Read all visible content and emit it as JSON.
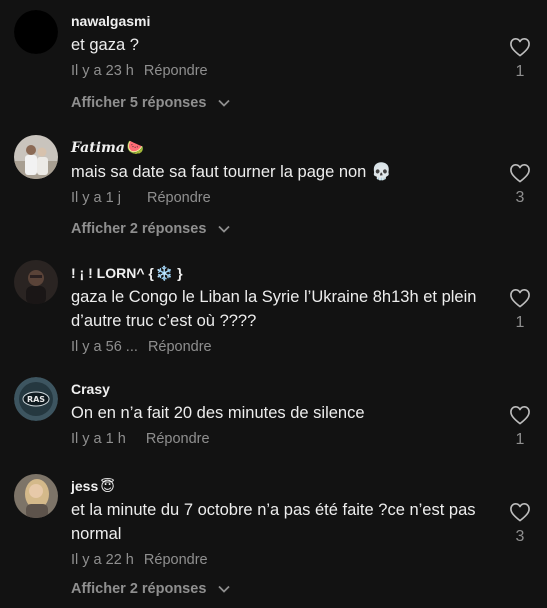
{
  "comments": [
    {
      "username": "nawalgasmi",
      "username_extra": "",
      "text": "et gaza ?",
      "time": "Il y a 23 h",
      "reply_label": "Répondre",
      "likes": "1",
      "replies_label": "Afficher 5 réponses",
      "avatar": "black-circle"
    },
    {
      "username": "Fatima",
      "username_extra": "🍉",
      "text": "mais sa date sa faut tourner la page non 💀",
      "time": "Il y a 1 j",
      "reply_label": "Répondre",
      "likes": "3",
      "replies_label": "Afficher 2 réponses",
      "avatar": "photo-couple"
    },
    {
      "username": "! ¡ ! LORN^ {",
      "username_extra": "❄️ }",
      "text": "gaza le Congo le Liban la Syrie l’Ukraine 8h13h et plein d’autre truc c’est où ????",
      "time": "Il y a 56 ...",
      "reply_label": "Répondre",
      "likes": "1",
      "replies_label": "",
      "avatar": "photo-dark-person"
    },
    {
      "username": "Crasy",
      "username_extra": "",
      "text": "On en n’a fait 20 des minutes de silence",
      "time": "Il y a 1 h",
      "reply_label": "Répondre",
      "likes": "1",
      "replies_label": "",
      "avatar": "logo-badge"
    },
    {
      "username": "jess",
      "username_extra": "😇",
      "text": "et la minute du 7 octobre n’a pas été faite ?ce n’est pas normal",
      "time": "Il y a 22 h",
      "reply_label": "Répondre",
      "likes": "3",
      "replies_label": "Afficher 2 réponses",
      "avatar": "photo-blonde"
    }
  ],
  "icons": {
    "like": "heart-outline-icon",
    "expand": "chevron-down-icon"
  },
  "colors": {
    "background": "#121212",
    "primary_text": "#ededed",
    "secondary_text": "#8f8f8f"
  }
}
